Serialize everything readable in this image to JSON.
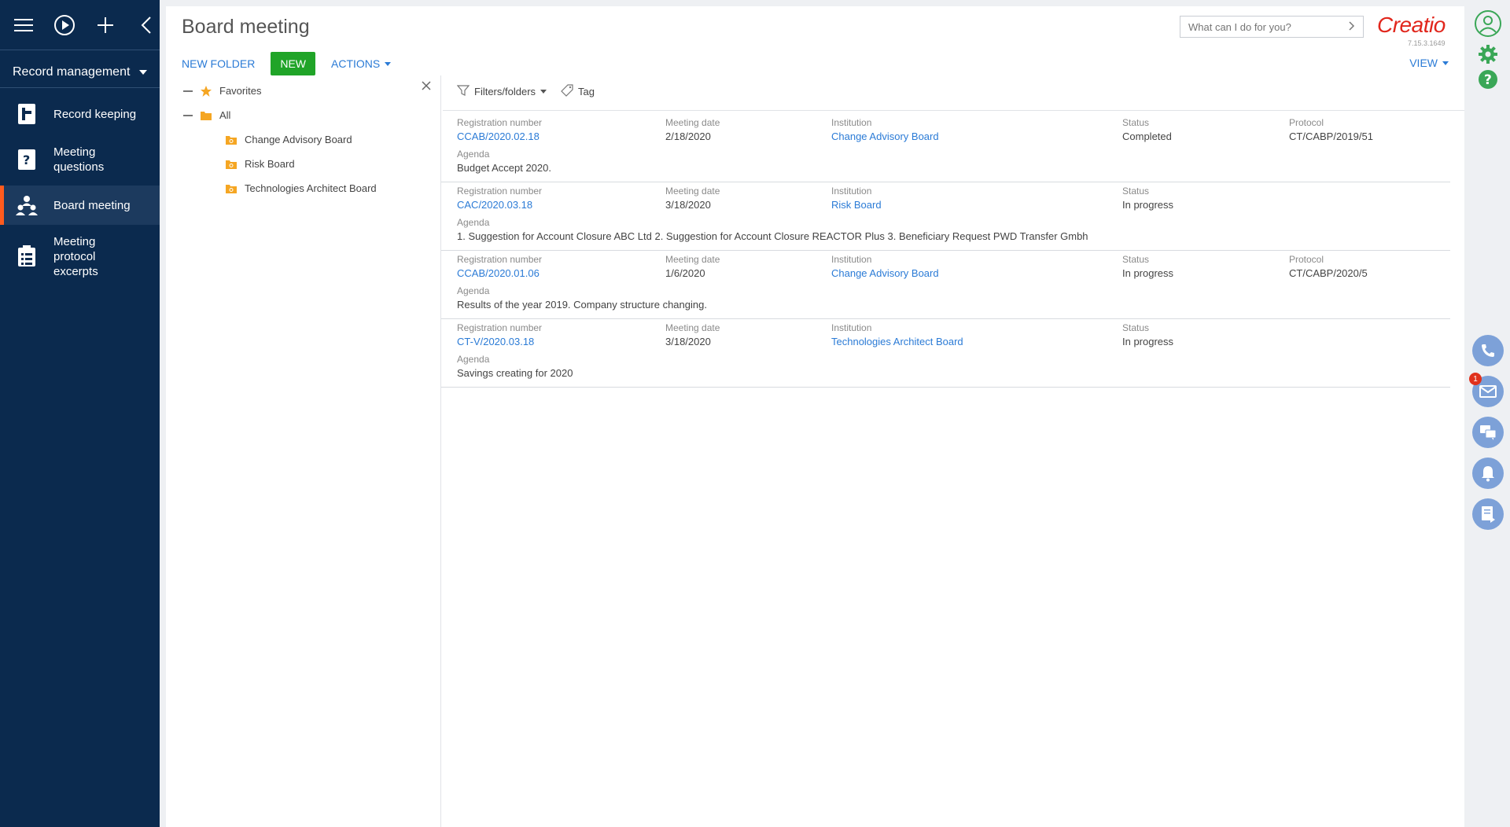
{
  "sidebar": {
    "workplace": "Record management",
    "items": [
      {
        "label": "Record keeping",
        "icon": "record-keeping-icon"
      },
      {
        "label": "Meeting questions",
        "icon": "meeting-questions-icon"
      },
      {
        "label": "Board meeting",
        "icon": "board-meeting-icon",
        "active": true
      },
      {
        "label": "Meeting protocol excerpts",
        "icon": "protocol-excerpts-icon"
      }
    ]
  },
  "header": {
    "title": "Board meeting",
    "new_folder": "NEW FOLDER",
    "new": "NEW",
    "actions": "ACTIONS",
    "view": "VIEW",
    "search_placeholder": "What can I do for you?",
    "logo": "Creatio",
    "version": "7.15.3.1649"
  },
  "folders": {
    "favorites": "Favorites",
    "all": "All",
    "items": [
      "Change Advisory Board",
      "Risk Board",
      "Technologies Architect Board"
    ]
  },
  "grid_toolbar": {
    "filters": "Filters/folders",
    "tag": "Tag"
  },
  "labels": {
    "reg": "Registration number",
    "date": "Meeting date",
    "inst": "Institution",
    "status": "Status",
    "proto": "Protocol",
    "agenda": "Agenda"
  },
  "records": [
    {
      "reg": "CCAB/2020.02.18",
      "date": "2/18/2020",
      "inst": "Change Advisory Board",
      "status": "Completed",
      "proto": "CT/CABP/2019/51",
      "agenda": "Budget Accept 2020."
    },
    {
      "reg": "CAC/2020.03.18",
      "date": "3/18/2020",
      "inst": "Risk Board",
      "status": "In progress",
      "proto": "",
      "agenda": "1. Suggestion for Account Closure ABC Ltd 2. Suggestion for Account Closure REACTOR Plus 3. Beneficiary Request PWD Transfer Gmbh"
    },
    {
      "reg": "CCAB/2020.01.06",
      "date": "1/6/2020",
      "inst": "Change Advisory Board",
      "status": "In progress",
      "proto": "CT/CABP/2020/5",
      "agenda": "Results of the year 2019. Company structure changing."
    },
    {
      "reg": "CT-V/2020.03.18",
      "date": "3/18/2020",
      "inst": "Technologies Architect Board",
      "status": "In progress",
      "proto": "",
      "agenda": "Savings creating for 2020"
    }
  ],
  "rightbar": {
    "email_badge": "1"
  },
  "colors": {
    "sidebar_bg": "#0b2a4e",
    "accent_orange": "#ff5b1e",
    "new_button": "#20a428",
    "link_blue": "#2b7bd6",
    "logo_red": "#e1261c"
  }
}
